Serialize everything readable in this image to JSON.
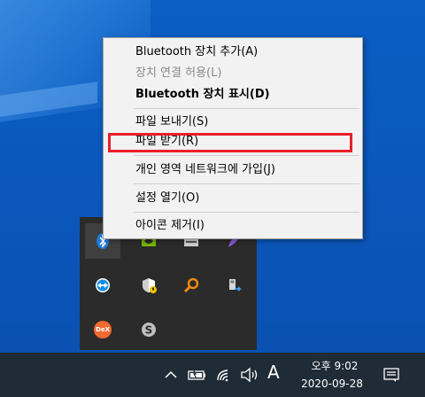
{
  "context_menu": {
    "items": [
      {
        "label": "Bluetooth 장치 추가(A)",
        "state": "normal"
      },
      {
        "label": "장치 연결 허용(L)",
        "state": "disabled"
      },
      {
        "label": "Bluetooth 장치 표시(D)",
        "state": "bold"
      },
      {
        "label": "파일 보내기(S)",
        "state": "normal"
      },
      {
        "label": "파일 받기(R)",
        "state": "highlighted"
      },
      {
        "label": "개인 영역 네트워크에 가입(J)",
        "state": "normal"
      },
      {
        "label": "설정 열기(O)",
        "state": "normal"
      },
      {
        "label": "아이콘 제거(I)",
        "state": "normal"
      }
    ],
    "highlight_color": "#e8202a"
  },
  "tray_flyout": {
    "icons": [
      "bluetooth-icon",
      "nvidia-icon",
      "keyboard-icon",
      "feather-icon",
      "teamviewer-icon",
      "security-shield-icon",
      "search-magnifier-icon",
      "usb-remove-icon",
      "dex-icon",
      "skype-icon"
    ],
    "dex_label": "DeX"
  },
  "taskbar": {
    "ime_indicator": "A",
    "time": "오후 9:02",
    "date": "2020-09-28",
    "icons": [
      "chevron-up-icon",
      "battery-icon",
      "wifi-icon",
      "speaker-icon",
      "notification-icon"
    ]
  },
  "colors": {
    "desktop": "#0a5fc4",
    "taskbar": "#1f2b36",
    "menu_bg": "#f2f2f2"
  }
}
